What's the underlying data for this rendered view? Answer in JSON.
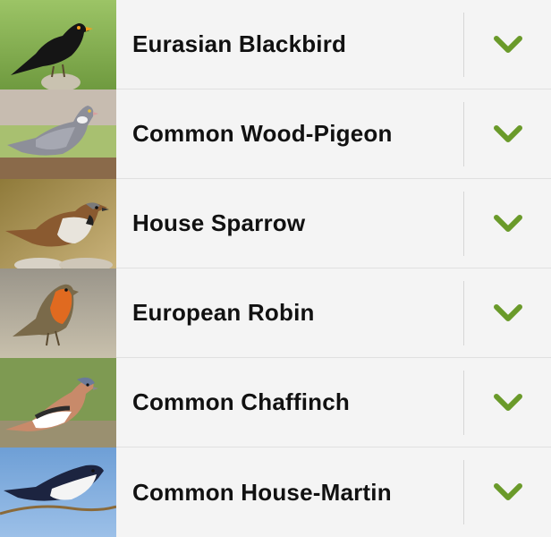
{
  "birds": [
    {
      "name": "Eurasian Blackbird",
      "image_icon": "blackbird-photo",
      "action_icon": "chevron-down-icon"
    },
    {
      "name": "Common Wood-Pigeon",
      "image_icon": "wood-pigeon-photo",
      "action_icon": "chevron-down-icon"
    },
    {
      "name": "House Sparrow",
      "image_icon": "house-sparrow-photo",
      "action_icon": "chevron-down-icon"
    },
    {
      "name": "European Robin",
      "image_icon": "european-robin-photo",
      "action_icon": "chevron-down-icon"
    },
    {
      "name": "Common Chaffinch",
      "image_icon": "chaffinch-photo",
      "action_icon": "chevron-down-icon"
    },
    {
      "name": "Common House-Martin",
      "image_icon": "house-martin-photo",
      "action_icon": "chevron-down-icon"
    }
  ],
  "colors": {
    "chevron": "#6a9a2a",
    "row_background": "#f4f4f4",
    "divider": "#d6d6d6",
    "text": "#111111"
  }
}
